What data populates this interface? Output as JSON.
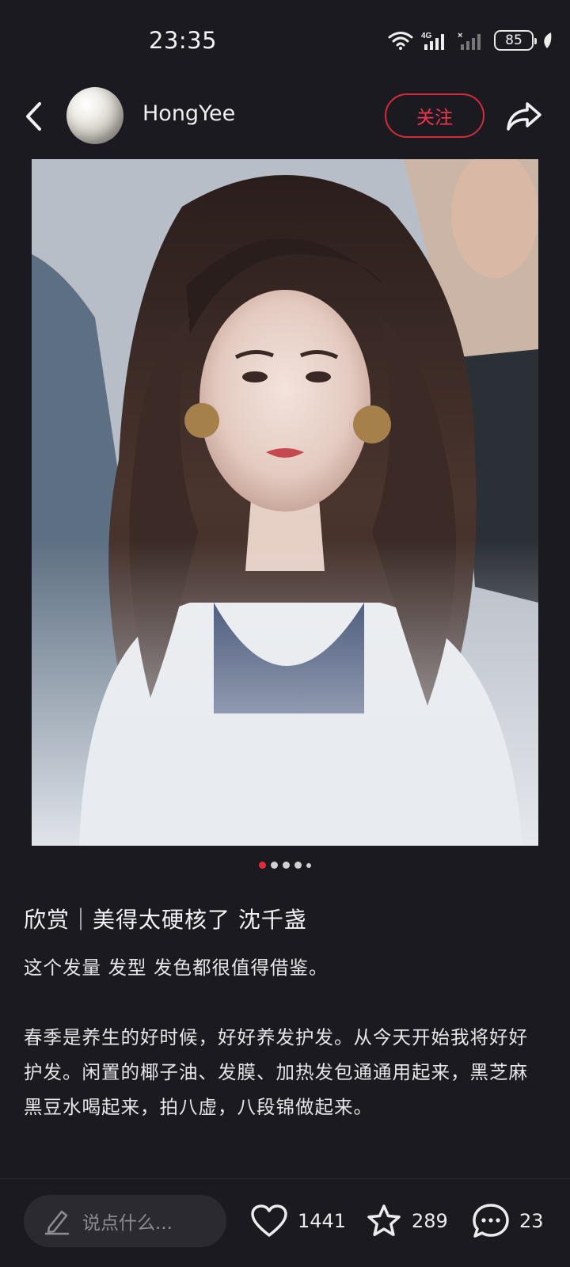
{
  "status_bar": {
    "time": "23:35",
    "battery": "85",
    "network": "4G",
    "icons": [
      "wifi-icon",
      "signal-4g-icon",
      "signal-no-sim-icon",
      "battery-icon",
      "leaf-icon"
    ]
  },
  "header": {
    "username": "HongYee",
    "follow_label": "关注",
    "icons": [
      "back-arrow-icon",
      "share-icon"
    ]
  },
  "carousel": {
    "total": 5,
    "active_index": 0
  },
  "post": {
    "title": "欣赏｜美得太硬核了 沈千盏",
    "body": "这个发量 发型 发色都很值得借鉴。\n\n春季是养生的好时候，好好养发护发。从今天开始我将好好护发。闲置的椰子油、发膜、加热发包通通用起来，黑芝麻黑豆水喝起来，拍八虚，八段锦做起来。"
  },
  "bottom_bar": {
    "comment_placeholder": "说点什么...",
    "likes": "1441",
    "stars": "289",
    "comments": "23"
  },
  "colors": {
    "background": "#1b1a20",
    "accent_red": "#e32a3b",
    "text_primary": "#ecebef",
    "text_muted": "#8d8c93"
  }
}
